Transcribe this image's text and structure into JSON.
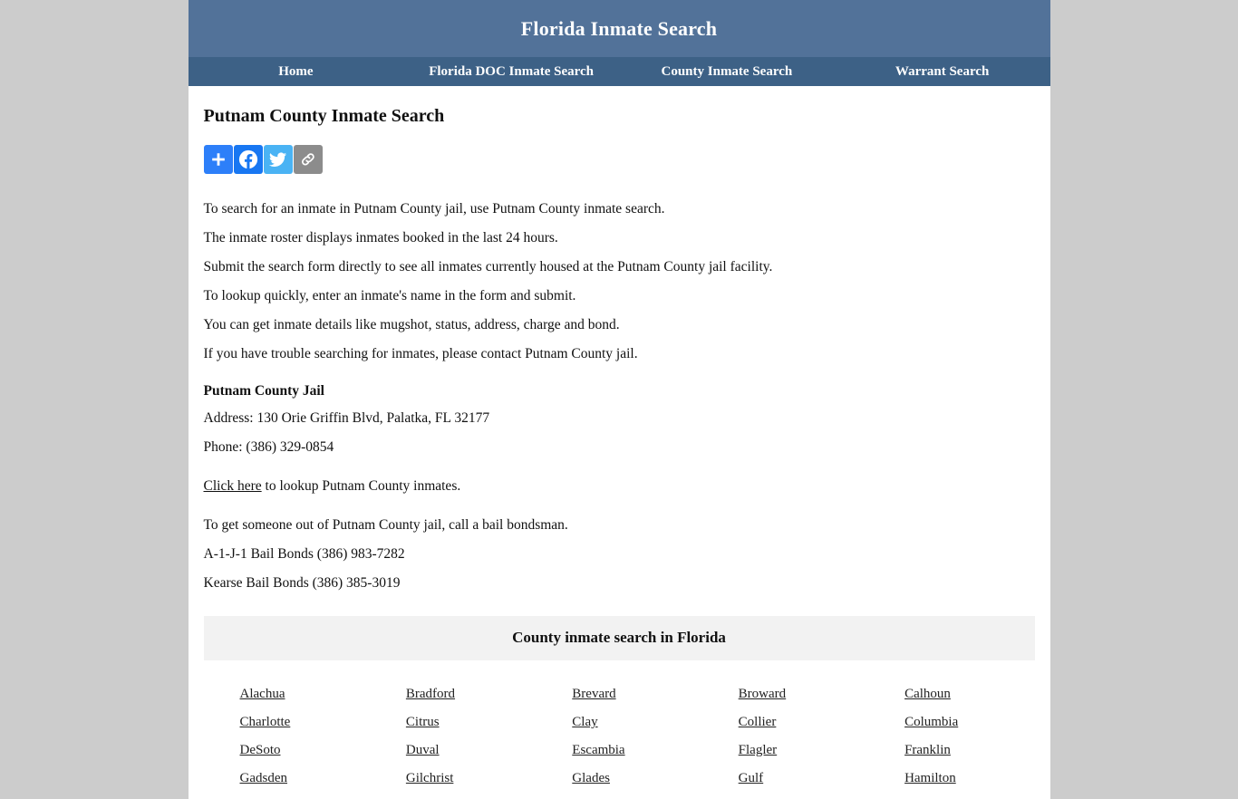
{
  "site": {
    "title": "Florida Inmate Search",
    "nav": [
      {
        "label": "Home",
        "name": "nav-home"
      },
      {
        "label": "Florida DOC Inmate Search",
        "name": "nav-florida-doc-inmate-search"
      },
      {
        "label": "County Inmate Search",
        "name": "nav-county-inmate-search"
      },
      {
        "label": "Warrant Search",
        "name": "nav-warrant-search"
      }
    ],
    "colors": {
      "header_bg": "#527299",
      "nav_bg": "#3d6186",
      "page_bg": "#cccccc",
      "content_bg": "#ffffff",
      "table_header_bg": "#f2f2f2"
    }
  },
  "page": {
    "title": "Putnam County Inmate Search"
  },
  "share": {
    "buttons": [
      {
        "name": "share-addthis-button",
        "icon": "plus-icon",
        "label": "Share",
        "color": "#2d7ff9"
      },
      {
        "name": "share-facebook-button",
        "icon": "facebook-icon",
        "label": "Facebook",
        "color": "#1877f2"
      },
      {
        "name": "share-twitter-button",
        "icon": "twitter-icon",
        "label": "Twitter",
        "color": "#4ab3f4"
      },
      {
        "name": "share-copy-link-button",
        "icon": "link-icon",
        "label": "Copy Link",
        "color": "#8c8c8c"
      }
    ]
  },
  "intro": {
    "lines": [
      "To search for an inmate in Putnam County jail, use Putnam County inmate search.",
      "The inmate roster displays inmates booked in the last 24 hours.",
      "Submit the search form directly to see all inmates currently housed at the Putnam County jail facility.",
      "To lookup quickly, enter an inmate's name in the form and submit.",
      "You can get inmate details like mugshot, status, address, charge and bond.",
      "If you have trouble searching for inmates, please contact Putnam County jail."
    ]
  },
  "jail": {
    "name": "Putnam County Jail",
    "address": "Address: 130 Orie Griffin Blvd, Palatka, FL 32177",
    "phone": "Phone: (386) 329-0854"
  },
  "lookup": {
    "link_text": "Click here",
    "rest_text": " to lookup Putnam County inmates."
  },
  "bail": {
    "intro": "To get someone out of Putnam County jail, call a bail bondsman.",
    "bondsmen": [
      "A-1-J-1 Bail Bonds (386) 983-7282",
      "Kearse Bail Bonds (386) 385-3019"
    ]
  },
  "county_table": {
    "header": "County inmate search in Florida",
    "rows": [
      [
        "Alachua",
        "Bradford",
        "Brevard",
        "Broward",
        "Calhoun"
      ],
      [
        "Charlotte",
        "Citrus",
        "Clay",
        "Collier",
        "Columbia"
      ],
      [
        "DeSoto",
        "Duval",
        "Escambia",
        "Flagler",
        "Franklin"
      ],
      [
        "Gadsden",
        "Gilchrist",
        "Glades",
        "Gulf",
        "Hamilton"
      ]
    ]
  }
}
